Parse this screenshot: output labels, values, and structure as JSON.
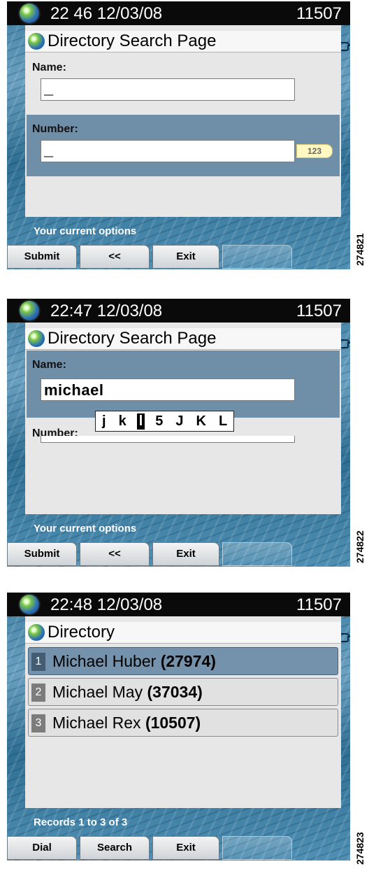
{
  "screens": [
    {
      "header": {
        "clock": "22 46 12/03/08",
        "extension": "11507"
      },
      "title": "Directory Search Page",
      "name_label": "Name:",
      "name_value": "_",
      "number_label": "Number:",
      "number_value": "_",
      "number_badge": "123",
      "status": "Your current options",
      "softkeys": [
        "Submit",
        "<<",
        "Exit"
      ],
      "figure_id": "274821"
    },
    {
      "header": {
        "clock": "22:47 12/03/08",
        "extension": "11507"
      },
      "title": "Directory Search Page",
      "name_label": "Name:",
      "name_value": "michael",
      "number_label": "Number:",
      "suggestions": [
        "j",
        "k",
        "l",
        "5",
        "J",
        "K",
        "L"
      ],
      "selected_suggestion": "l",
      "status": "Your current options",
      "softkeys": [
        "Submit",
        "<<",
        "Exit"
      ],
      "figure_id": "274822"
    },
    {
      "header": {
        "clock": "22:48 12/03/08",
        "extension": "11507"
      },
      "title": "Directory",
      "entries": [
        {
          "index": "1",
          "name": "Michael Huber",
          "number": "(27974)"
        },
        {
          "index": "2",
          "name": "Michael May",
          "number": "(37034)"
        },
        {
          "index": "3",
          "name": "Michael Rex",
          "number": "(10507)"
        }
      ],
      "selected_entry": "1",
      "status": "Records 1 to 3 of 3",
      "softkeys": [
        "Dial",
        "Search",
        "Exit"
      ],
      "figure_id": "274823"
    }
  ],
  "icons": [
    "globe-icon",
    "phone-icon"
  ]
}
